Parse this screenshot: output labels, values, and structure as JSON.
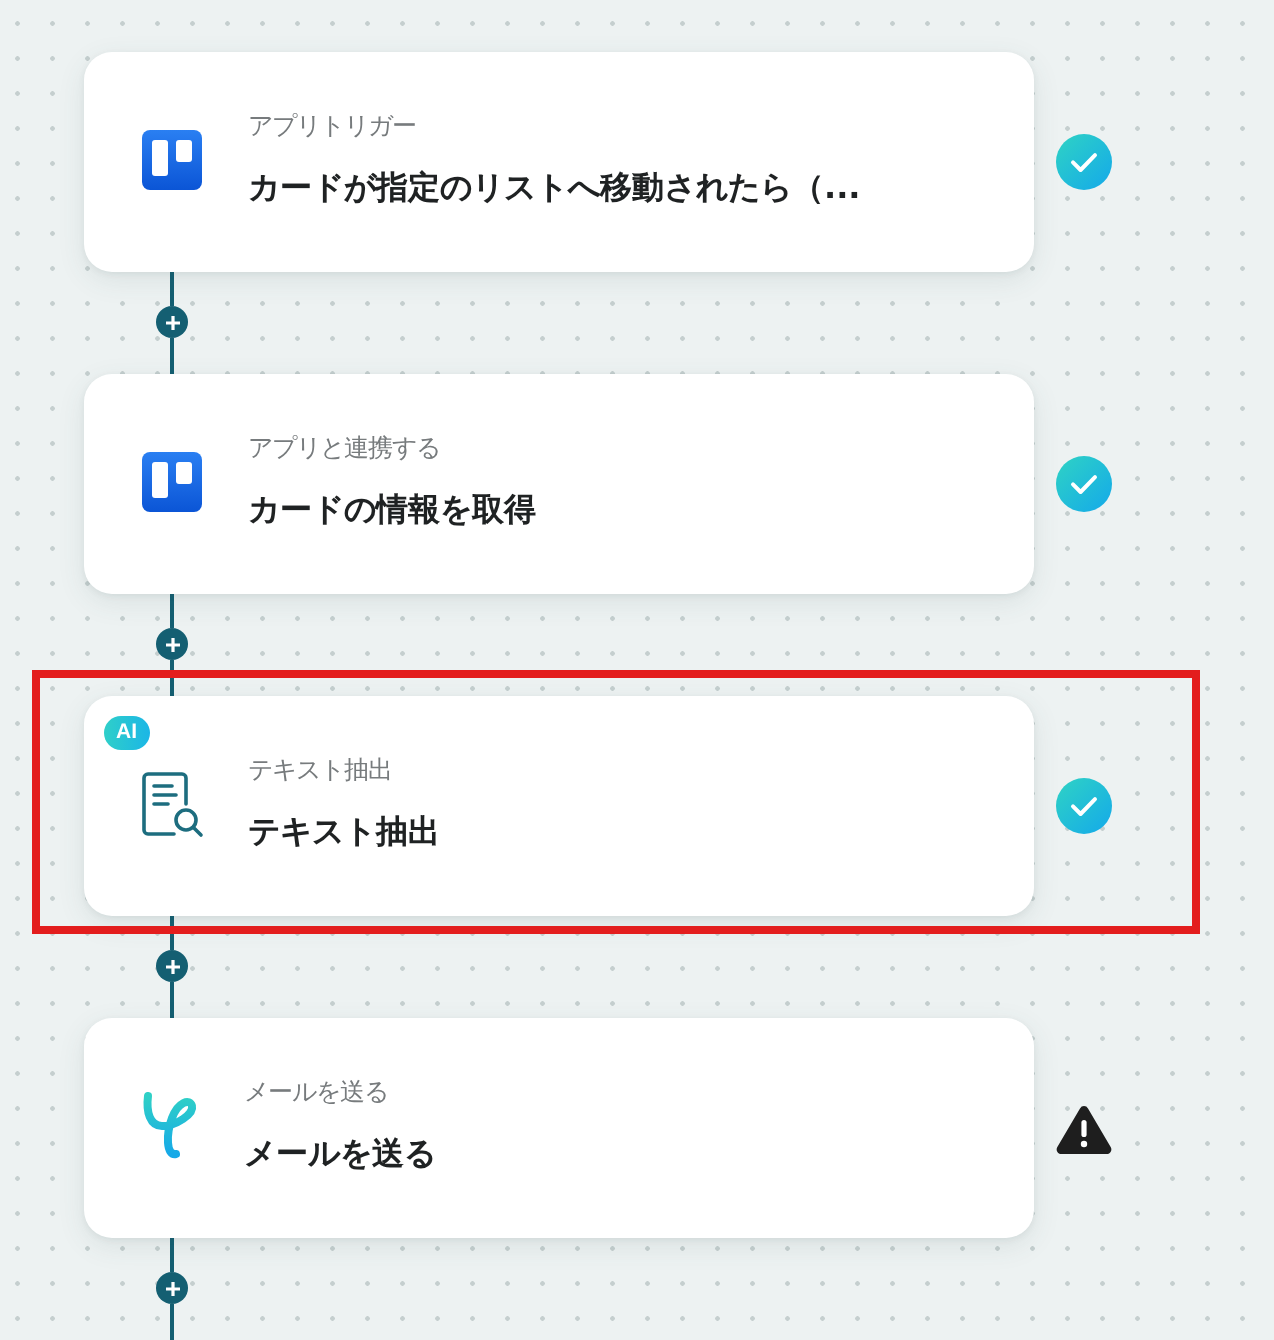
{
  "steps": [
    {
      "kind": "board",
      "category": "アプリトリガー",
      "title": "カードが指定のリストへ移動されたら（...",
      "complete": true,
      "highlighted": false
    },
    {
      "kind": "board",
      "category": "アプリと連携する",
      "title": "カードの情報を取得",
      "complete": true,
      "highlighted": false
    },
    {
      "kind": "extraction",
      "badge": "AI",
      "category": "テキスト抽出",
      "title": "テキスト抽出",
      "complete": true,
      "highlighted": true
    },
    {
      "kind": "mail",
      "category": "メールを送る",
      "title": "メールを送る",
      "complete": false,
      "highlighted": false
    }
  ]
}
